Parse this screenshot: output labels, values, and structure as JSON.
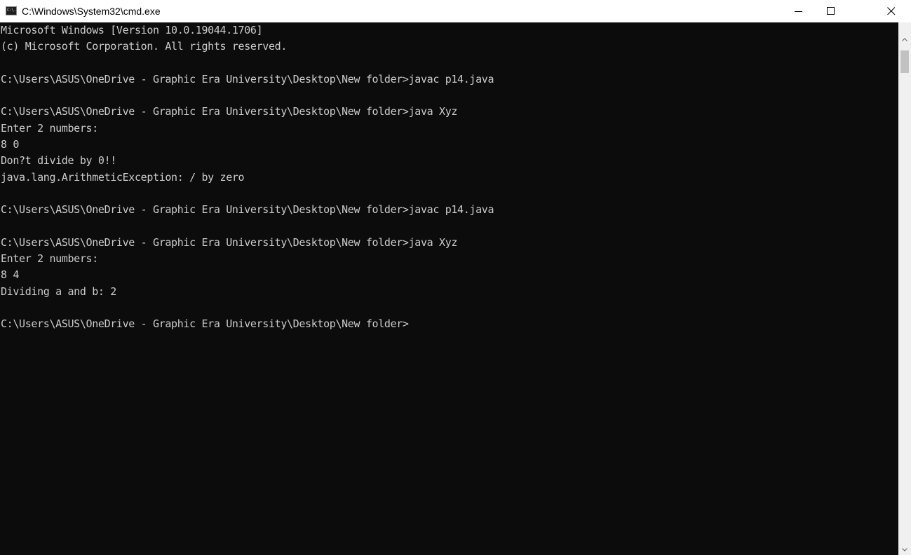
{
  "window": {
    "title": "C:\\Windows\\System32\\cmd.exe",
    "icon": "cmd-app-icon",
    "icon_glyph": "C:\\."
  },
  "controls": {
    "minimize": "minimize-icon",
    "maximize": "maximize-icon",
    "close": "close-icon"
  },
  "console": {
    "lines": [
      "Microsoft Windows [Version 10.0.19044.1706]",
      "(c) Microsoft Corporation. All rights reserved.",
      "",
      "C:\\Users\\ASUS\\OneDrive - Graphic Era University\\Desktop\\New folder>javac p14.java",
      "",
      "C:\\Users\\ASUS\\OneDrive - Graphic Era University\\Desktop\\New folder>java Xyz",
      "Enter 2 numbers:",
      "8 0",
      "Don?t divide by 0!!",
      "java.lang.ArithmeticException: / by zero",
      "",
      "C:\\Users\\ASUS\\OneDrive - Graphic Era University\\Desktop\\New folder>javac p14.java",
      "",
      "C:\\Users\\ASUS\\OneDrive - Graphic Era University\\Desktop\\New folder>java Xyz",
      "Enter 2 numbers:",
      "8 4",
      "Dividing a and b: 2",
      "",
      "C:\\Users\\ASUS\\OneDrive - Graphic Era University\\Desktop\\New folder>"
    ]
  },
  "scrollbar": {
    "up": "chevron-up-icon",
    "down": "chevron-down-icon"
  },
  "colors": {
    "console_bg": "#0c0c0c",
    "console_text": "#cccccc",
    "titlebar_bg": "#ffffff"
  }
}
